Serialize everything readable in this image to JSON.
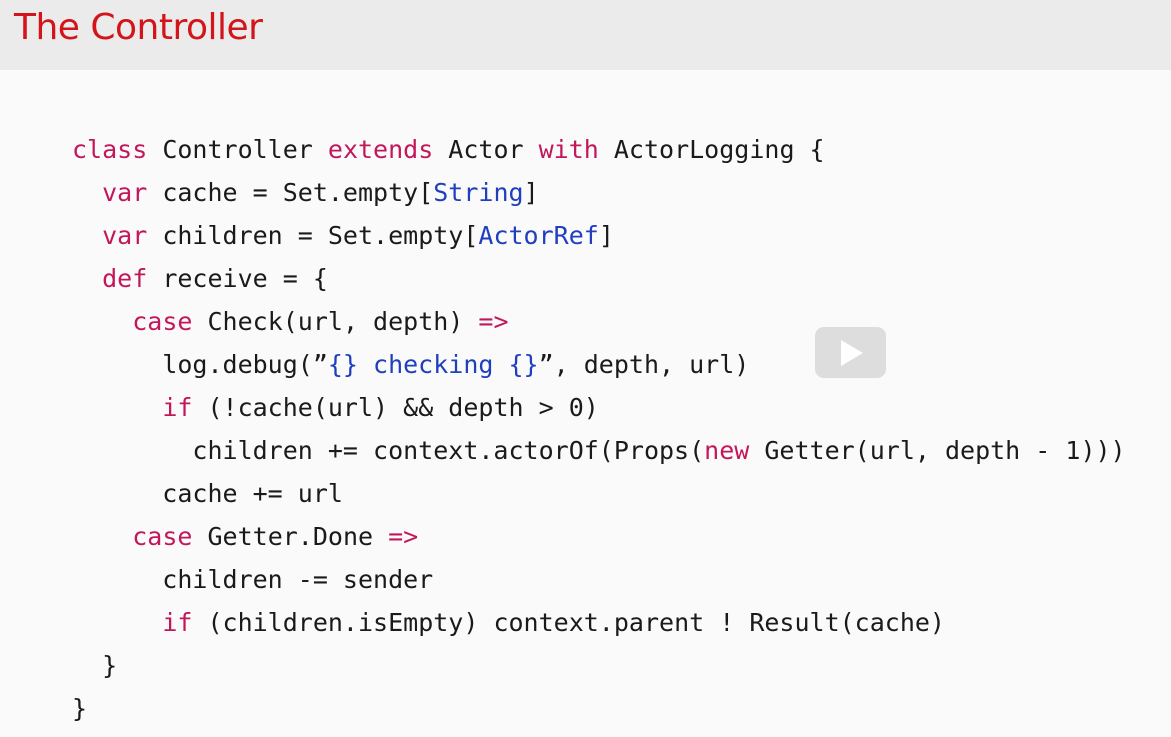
{
  "slide": {
    "title": "The Controller"
  },
  "code_lines": [
    [
      {
        "t": "class",
        "c": "kw"
      },
      {
        "t": " Controller "
      },
      {
        "t": "extends",
        "c": "kw"
      },
      {
        "t": " Actor "
      },
      {
        "t": "with",
        "c": "kw"
      },
      {
        "t": " ActorLogging {"
      }
    ],
    [
      {
        "t": "  "
      },
      {
        "t": "var",
        "c": "kw"
      },
      {
        "t": " cache = Set.empty["
      },
      {
        "t": "String",
        "c": "ty"
      },
      {
        "t": "]"
      }
    ],
    [
      {
        "t": "  "
      },
      {
        "t": "var",
        "c": "kw"
      },
      {
        "t": " children = Set.empty["
      },
      {
        "t": "ActorRef",
        "c": "ty"
      },
      {
        "t": "]"
      }
    ],
    [
      {
        "t": "  "
      },
      {
        "t": "def",
        "c": "kw"
      },
      {
        "t": " receive = {"
      }
    ],
    [
      {
        "t": "    "
      },
      {
        "t": "case",
        "c": "kw"
      },
      {
        "t": " Check(url, depth) "
      },
      {
        "t": "=>",
        "c": "kw"
      }
    ],
    [
      {
        "t": "      log.debug(”"
      },
      {
        "t": "{} checking {}",
        "c": "st"
      },
      {
        "t": "”, depth, url)"
      }
    ],
    [
      {
        "t": "      "
      },
      {
        "t": "if",
        "c": "kw"
      },
      {
        "t": " (!cache(url) && depth > 0)"
      }
    ],
    [
      {
        "t": "        children += context.actorOf(Props("
      },
      {
        "t": "new",
        "c": "kw"
      },
      {
        "t": " Getter(url, depth - 1)))"
      }
    ],
    [
      {
        "t": "      cache += url"
      }
    ],
    [
      {
        "t": "    "
      },
      {
        "t": "case",
        "c": "kw"
      },
      {
        "t": " Getter.Done "
      },
      {
        "t": "=>",
        "c": "kw"
      }
    ],
    [
      {
        "t": "      children -= sender"
      }
    ],
    [
      {
        "t": "      "
      },
      {
        "t": "if",
        "c": "kw"
      },
      {
        "t": " (children.isEmpty) context.parent ! Result(cache)"
      }
    ],
    [
      {
        "t": "  }"
      }
    ],
    [
      {
        "t": "}"
      }
    ]
  ],
  "player": {
    "play_icon": "play-icon"
  },
  "colors": {
    "title": "#d3141a",
    "keyword": "#c2185b",
    "type": "#1f3fbf",
    "text": "#1a1a1a",
    "title_bar_bg": "#ebebeb",
    "slide_bg": "#fafafa"
  }
}
